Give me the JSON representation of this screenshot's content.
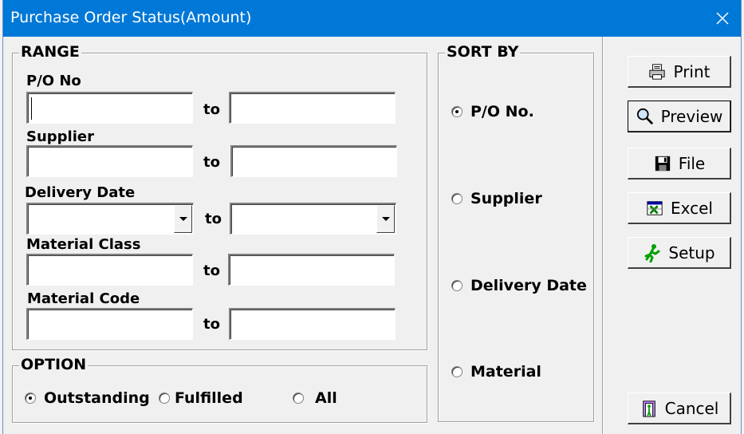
{
  "window": {
    "title": "Purchase Order Status(Amount)"
  },
  "range": {
    "label": "RANGE",
    "to_label": "to",
    "fields": [
      {
        "label": "P/O No",
        "from": "",
        "to": ""
      },
      {
        "label": "Supplier",
        "from": "",
        "to": ""
      },
      {
        "label": "Delivery Date",
        "from": "",
        "to": ""
      },
      {
        "label": "Material Class",
        "from": "",
        "to": ""
      },
      {
        "label": "Material Code",
        "from": "",
        "to": ""
      }
    ]
  },
  "option": {
    "label": "OPTION",
    "items": [
      {
        "label": "Outstanding",
        "selected": true
      },
      {
        "label": "Fulfilled",
        "selected": false
      },
      {
        "label": "All",
        "selected": false
      }
    ]
  },
  "sort_by": {
    "label": "SORT BY",
    "items": [
      {
        "label": "P/O No.",
        "selected": true
      },
      {
        "label": "Supplier",
        "selected": false
      },
      {
        "label": "Delivery Date",
        "selected": false
      },
      {
        "label": "Material",
        "selected": false
      }
    ]
  },
  "buttons": {
    "print": "Print",
    "preview": "Preview",
    "file": "File",
    "excel": "Excel",
    "setup": "Setup",
    "cancel": "Cancel"
  }
}
